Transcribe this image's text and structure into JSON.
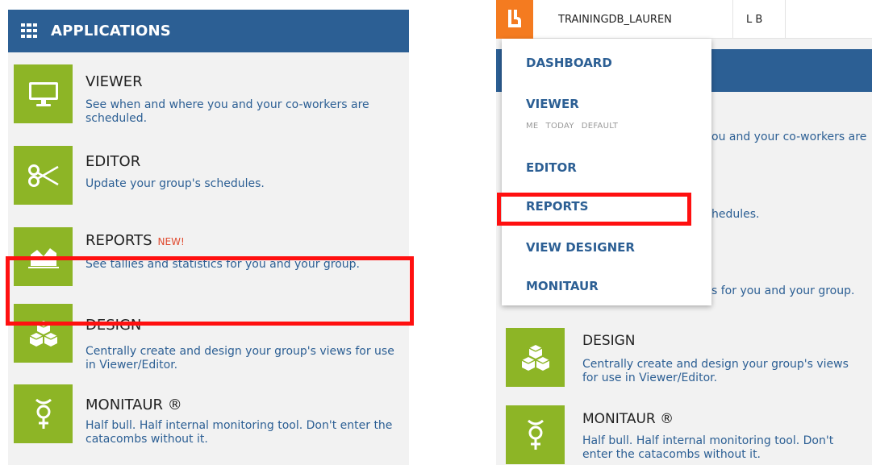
{
  "left": {
    "header_title": "APPLICATIONS",
    "apps": [
      {
        "name": "VIEWER",
        "desc": "See when and where you and your co-workers are scheduled.",
        "icon": "monitor-icon"
      },
      {
        "name": "EDITOR",
        "desc": "Update your group's schedules.",
        "icon": "scissors-icon"
      },
      {
        "name": "REPORTS",
        "badge": "NEW!",
        "desc": "See tallies and statistics for you and your group.",
        "icon": "area-chart-icon"
      },
      {
        "name": "DESIGN",
        "desc": "Centrally create and design your group's views for use in Viewer/Editor.",
        "icon": "cubes-icon"
      },
      {
        "name": "MONITAUR ®",
        "desc": "Half bull. Half internal monitoring tool. Don't enter the catacombs without it.",
        "icon": "mercury-icon"
      }
    ]
  },
  "right": {
    "topbar": {
      "db_tab": "TRAININGDB_LAUREN",
      "user_tab": "L B"
    },
    "menu": {
      "dashboard": "DASHBOARD",
      "viewer": "VIEWER",
      "viewer_sub": [
        "ME",
        "TODAY",
        "DEFAULT"
      ],
      "editor": "EDITOR",
      "reports": "REPORTS",
      "view_designer": "VIEW DESIGNER",
      "monitaur": "MONITAUR"
    },
    "partial": {
      "viewer_desc": "ou and your co-workers are",
      "editor_desc": "hedules.",
      "reports_desc": "s for you and your group."
    },
    "design": {
      "name": "DESIGN",
      "desc": "Centrally create and design your group's views for use in Viewer/Editor."
    },
    "monitaur": {
      "name": "MONITAUR ®",
      "desc": "Half bull. Half internal monitoring tool. Don't enter the catacombs without it."
    }
  },
  "colors": {
    "header_blue": "#2c5f94",
    "tile_green": "#8db526",
    "highlight_red": "#ff1010",
    "logo_orange": "#f47b20",
    "badge_red": "#e04a2f"
  }
}
